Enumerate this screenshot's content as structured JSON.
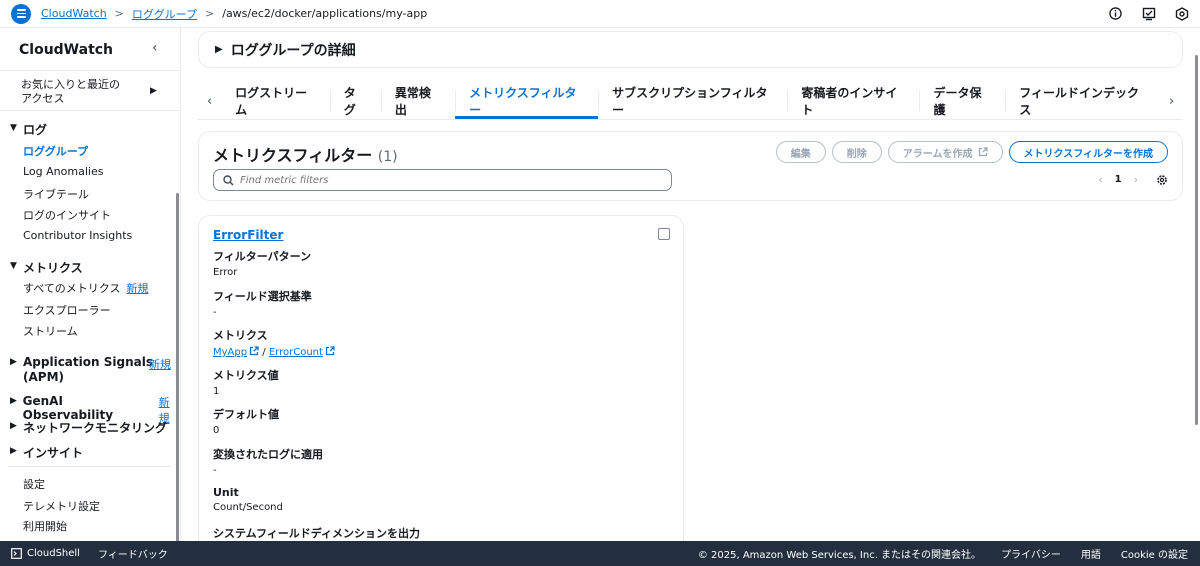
{
  "header": {
    "breadcrumbs": [
      "CloudWatch",
      "ロググループ"
    ],
    "current": "/aws/ec2/docker/applications/my-app",
    "icons": [
      "info-icon",
      "notifications-icon",
      "settings-icon"
    ]
  },
  "sidebar": {
    "title": "CloudWatch",
    "favorites_line1": "お気に入りと最近の",
    "favorites_line2": "アクセス",
    "logs": {
      "label": "ログ",
      "items": [
        "ロググループ",
        "Log Anomalies",
        "ライブテール",
        "ログのインサイト",
        "Contributor Insights"
      ]
    },
    "metrics": {
      "label": "メトリクス",
      "items": [
        "すべてのメトリクス",
        "エクスプローラー",
        "ストリーム"
      ],
      "new_badge": "新規"
    },
    "app_signals_line1": "Application Signals",
    "app_signals_line2": "(APM)",
    "app_signals_badge": "新規",
    "genai": "GenAI Observability",
    "genai_badge": "新規",
    "network": "ネットワークモニタリング",
    "insights": "インサイト",
    "bottom": [
      "設定",
      "テレメトリ設定",
      "利用開始"
    ]
  },
  "details": {
    "title": "ロググループの詳細"
  },
  "tabs": [
    "ログストリーム",
    "タグ",
    "異常検出",
    "メトリクスフィルター",
    "サブスクリプションフィルター",
    "寄稿者のインサイト",
    "データ保護",
    "フィールドインデックス"
  ],
  "active_tab": "メトリクスフィルター",
  "filters": {
    "title": "メトリクスフィルター",
    "count": "(1)",
    "buttons": {
      "edit": "編集",
      "delete": "削除",
      "alarm": "アラームを作成",
      "create": "メトリクスフィルターを作成"
    },
    "search_placeholder": "Find metric filters",
    "page": "1"
  },
  "card": {
    "name": "ErrorFilter",
    "fields": [
      {
        "label": "フィルターパターン",
        "value": "Error"
      },
      {
        "label": "フィールド選択基準",
        "value": "-"
      },
      {
        "label": "メトリクス",
        "namespace": "MyApp",
        "separator": "/",
        "metric": "ErrorCount"
      },
      {
        "label": "メトリクス値",
        "value": "1"
      },
      {
        "label": "デフォルト値",
        "value": "0"
      },
      {
        "label": "変換されたログに適用",
        "value": "-"
      },
      {
        "label": "Unit",
        "value": "Count/Second"
      },
      {
        "label": "システムフィールドディメンションを出力"
      }
    ]
  },
  "footer": {
    "cloudshell": "CloudShell",
    "feedback": "フィードバック",
    "copyright": "© 2025, Amazon Web Services, Inc. またはその関連会社。",
    "privacy": "プライバシー",
    "terms": "用語",
    "cookie": "Cookie の設定"
  },
  "colors": {
    "accent": "#0972d3",
    "footer_bg": "#232f3e",
    "border": "#e9ebed"
  }
}
